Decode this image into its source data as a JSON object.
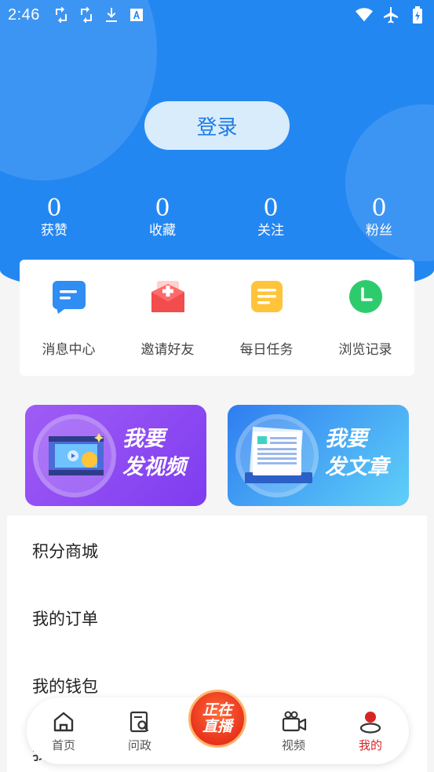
{
  "status_bar": {
    "time": "2:46",
    "left_icons": [
      "sync-icon",
      "sync-icon",
      "download-icon",
      "font-icon"
    ],
    "right_icons": [
      "wifi-icon",
      "airplane-icon",
      "battery-icon"
    ]
  },
  "header": {
    "login_label": "登录"
  },
  "stats": [
    {
      "value": "0",
      "label": "获赞"
    },
    {
      "value": "0",
      "label": "收藏"
    },
    {
      "value": "0",
      "label": "关注"
    },
    {
      "value": "0",
      "label": "粉丝"
    }
  ],
  "quick_actions": [
    {
      "label": "消息中心",
      "icon": "message-icon",
      "color": "#2f8df3"
    },
    {
      "label": "邀请好友",
      "icon": "invite-envelope-icon",
      "color": "#f24c4c"
    },
    {
      "label": "每日任务",
      "icon": "task-note-icon",
      "color": "#ffc43a"
    },
    {
      "label": "浏览记录",
      "icon": "clock-icon",
      "color": "#2ecb6d"
    }
  ],
  "banners": {
    "video": {
      "line1": "我要",
      "line2": "发视频"
    },
    "article": {
      "line1": "我要",
      "line2": "发文章"
    }
  },
  "menu": [
    {
      "label": "积分商城"
    },
    {
      "label": "我的订单"
    },
    {
      "label": "我的钱包"
    },
    {
      "label": "我的卡券"
    }
  ],
  "bottom_nav": {
    "items": [
      {
        "label": "首页",
        "icon": "home-icon"
      },
      {
        "label": "问政",
        "icon": "inquiry-icon"
      },
      {
        "label": "视频",
        "icon": "video-camera-icon"
      },
      {
        "label": "我的",
        "icon": "profile-icon"
      }
    ],
    "live": {
      "line1": "正在",
      "line2": "直播"
    },
    "active_color": "#d82424"
  }
}
